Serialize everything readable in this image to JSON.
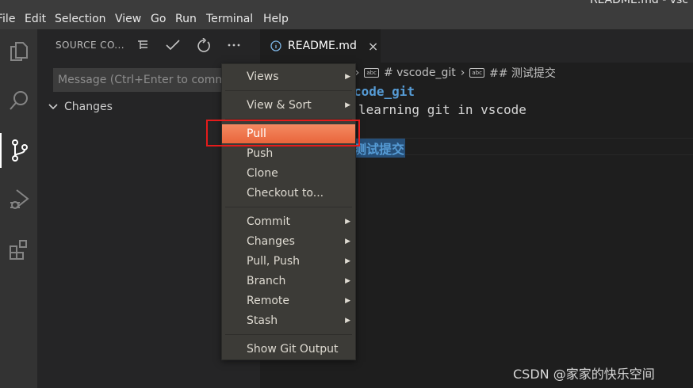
{
  "window_title": "README.md - vsc",
  "menubar": [
    "File",
    "Edit",
    "Selection",
    "View",
    "Go",
    "Run",
    "Terminal",
    "Help"
  ],
  "activity_bar": [
    "explorer-icon",
    "search-icon",
    "source-control-icon",
    "run-debug-icon",
    "extensions-icon"
  ],
  "sidebar": {
    "header": "SOURCE CO...",
    "actions": [
      "tree-view-icon",
      "commit-check-icon",
      "refresh-icon",
      "more-actions-icon"
    ],
    "message_placeholder": "Message (Ctrl+Enter to commit",
    "changes_label": "Changes"
  },
  "tab": {
    "label": "README.md",
    "close": "×"
  },
  "breadcrumb": {
    "file": "nd",
    "h1": "# vscode_git",
    "h2": "## 测试提交"
  },
  "editor": {
    "line1": "code_git",
    "line2": "learning git in vscode",
    "line3": "测试提交"
  },
  "context_menu": {
    "groups": [
      [
        {
          "label": "Views",
          "submenu": true
        }
      ],
      [
        {
          "label": "View & Sort",
          "submenu": true
        }
      ],
      [
        {
          "label": "Pull",
          "submenu": false,
          "highlighted": true
        },
        {
          "label": "Push",
          "submenu": false
        },
        {
          "label": "Clone",
          "submenu": false
        },
        {
          "label": "Checkout to...",
          "submenu": false
        }
      ],
      [
        {
          "label": "Commit",
          "submenu": true
        },
        {
          "label": "Changes",
          "submenu": true
        },
        {
          "label": "Pull, Push",
          "submenu": true
        },
        {
          "label": "Branch",
          "submenu": true
        },
        {
          "label": "Remote",
          "submenu": true
        },
        {
          "label": "Stash",
          "submenu": true
        }
      ],
      [
        {
          "label": "Show Git Output",
          "submenu": false
        }
      ]
    ]
  },
  "watermark": "CSDN @家家的快乐空间",
  "colors": {
    "accent_highlight": "#ed6d42",
    "annotation_box": "#e51b1b",
    "heading": "#569cd6"
  }
}
